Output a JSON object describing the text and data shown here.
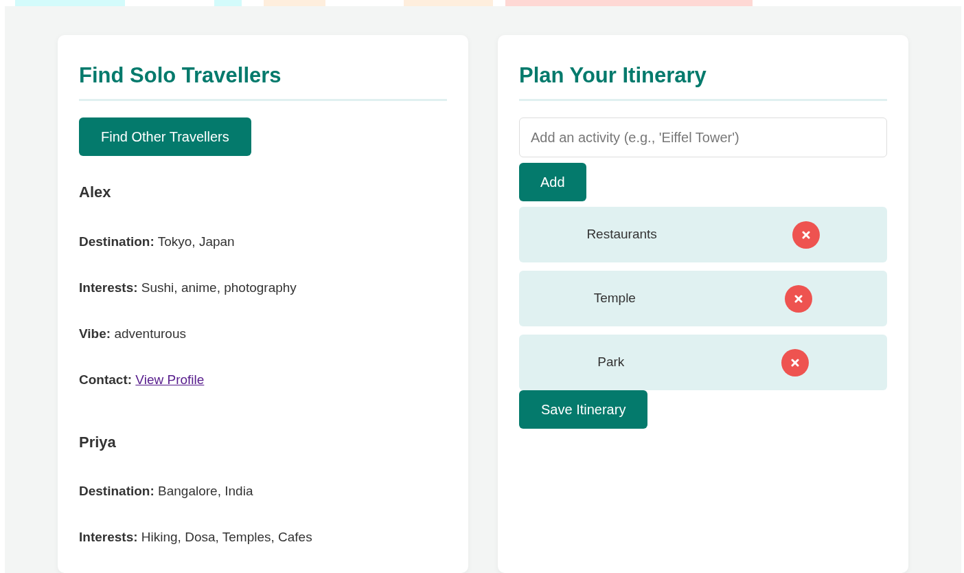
{
  "travellers_panel": {
    "title": "Find Solo Travellers",
    "find_button": "Find Other Travellers",
    "travellers": [
      {
        "name": "Alex",
        "details": [
          {
            "kind": "text",
            "label": "Destination:",
            "value": "Tokyo, Japan"
          },
          {
            "kind": "text",
            "label": "Interests:",
            "value": "Sushi, anime, photography"
          },
          {
            "kind": "text",
            "label": "Vibe:",
            "value": "adventurous"
          },
          {
            "kind": "link",
            "label": "Contact:",
            "value": "View Profile"
          }
        ]
      },
      {
        "name": "Priya",
        "details": [
          {
            "kind": "text",
            "label": "Destination:",
            "value": "Bangalore, India"
          },
          {
            "kind": "text",
            "label": "Interests:",
            "value": "Hiking, Dosa, Temples, Cafes"
          }
        ]
      }
    ]
  },
  "itinerary_panel": {
    "title": "Plan Your Itinerary",
    "activity_field": {
      "placeholder": "Add an activity (e.g., 'Eiffel Tower')"
    },
    "add_button": "Add",
    "activities": [
      {
        "name": "Restaurants"
      },
      {
        "name": "Temple"
      },
      {
        "name": "Park"
      }
    ],
    "save_button": "Save Itinerary"
  }
}
